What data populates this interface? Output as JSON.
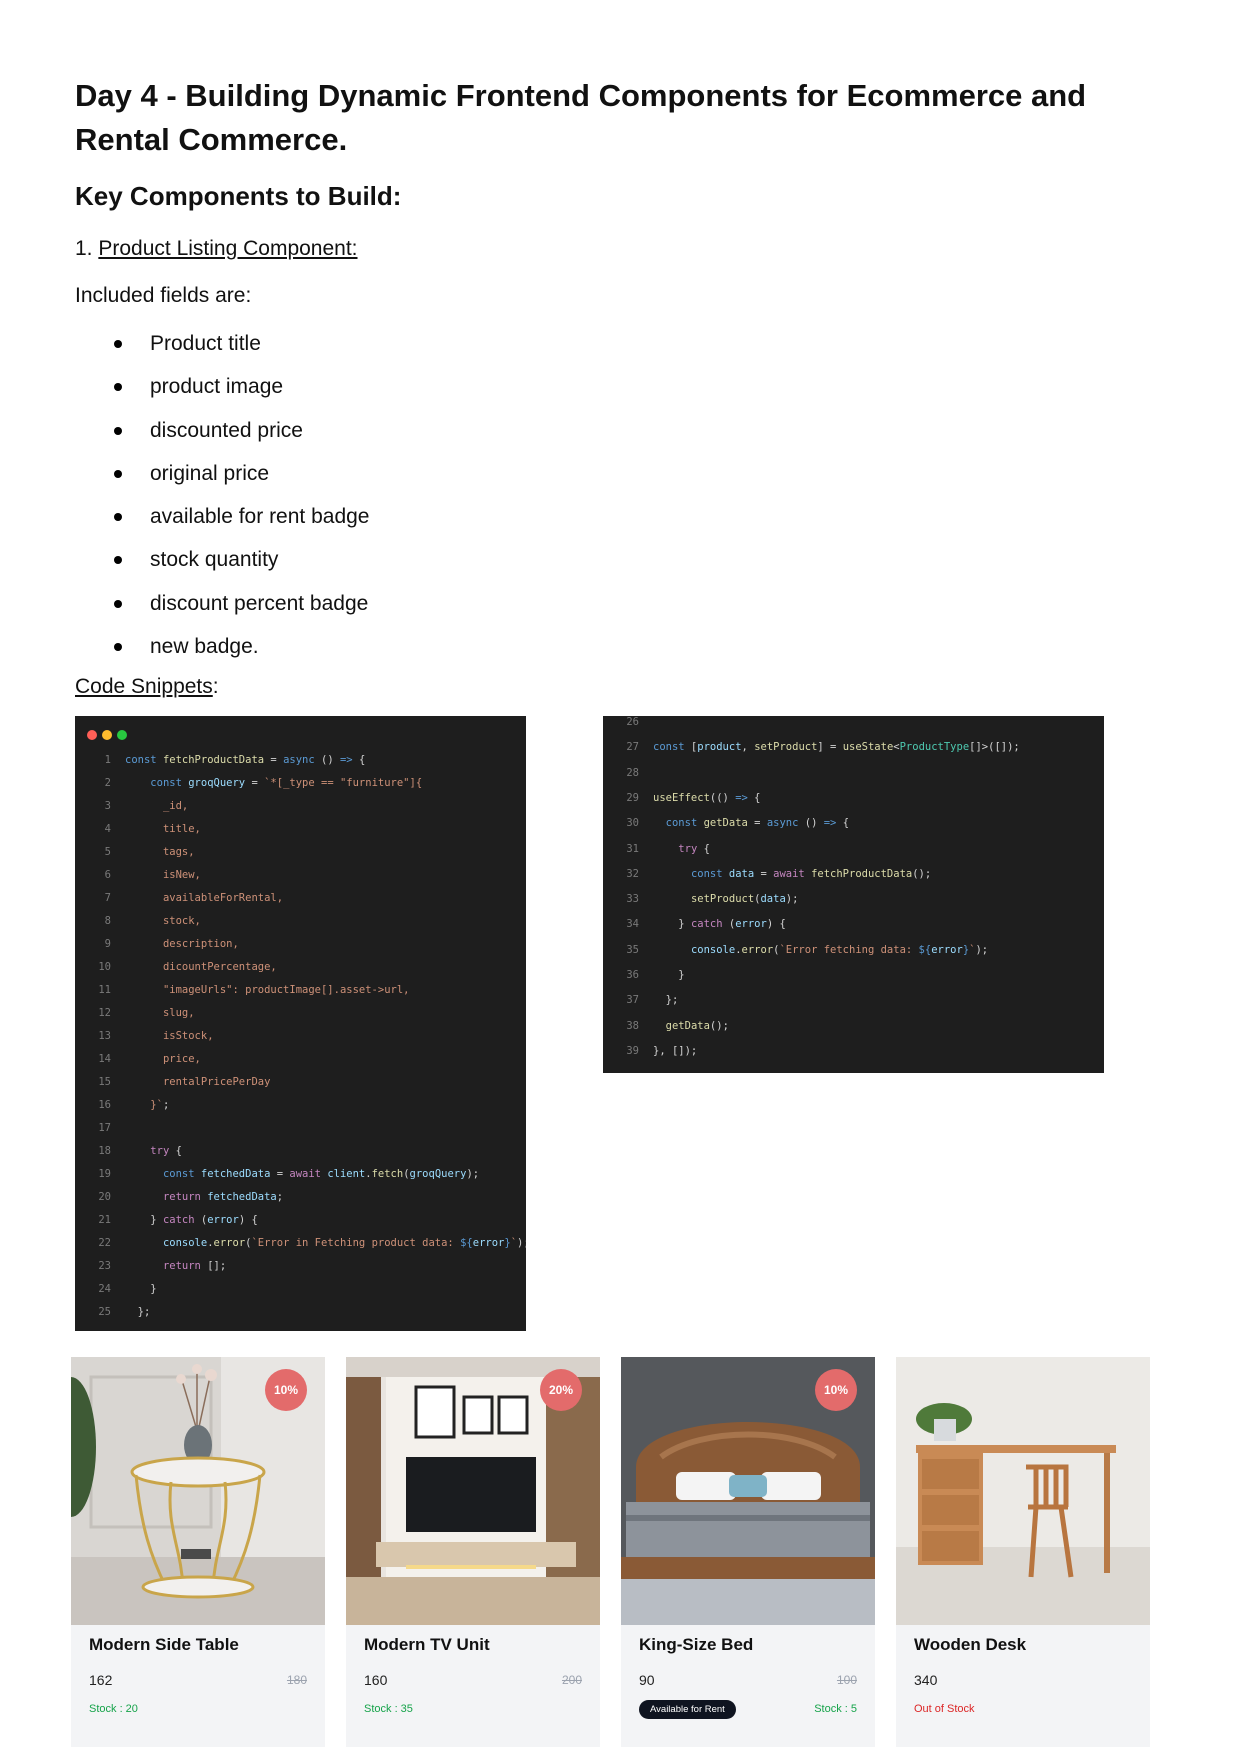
{
  "document": {
    "title": "Day 4 - Building Dynamic Frontend Components for Ecommerce and Rental Commerce.",
    "subtitle": "Key Components to Build:",
    "section_number": "1.",
    "section_title": "Product Listing Component:",
    "intro": "Included fields are:",
    "fields": [
      "Product title",
      "product image",
      "discounted price",
      "original price",
      "available for rent badge",
      "stock quantity",
      "discount percent badge",
      "new badge."
    ],
    "snippets_label": "Code Snippets",
    "snippets_colon": ":"
  },
  "colors": {
    "code_bg": "#1e1e1e",
    "window_dots": [
      "#ff5f57",
      "#febc2e",
      "#28c840"
    ],
    "discount_badge": "#e36b6b",
    "stock_in": "#16a34a",
    "stock_out": "#dc2626",
    "rent_badge": "#0f1420"
  },
  "code_left": {
    "lines": [
      {
        "n": "1",
        "html": "<span class=\"kw\">const</span> <span class=\"fn\">fetchProductData</span> = <span class=\"kw\">async</span> () <span class=\"kw\">=&gt;</span> {"
      },
      {
        "n": "2",
        "html": "    <span class=\"kw\">const</span> <span class=\"var\">groqQuery</span> = <span class=\"str\">`*[_type == \"furniture\"]{</span>"
      },
      {
        "n": "3",
        "html": "      <span class=\"str\">_id,</span>"
      },
      {
        "n": "4",
        "html": "      <span class=\"str\">title,</span>"
      },
      {
        "n": "5",
        "html": "      <span class=\"str\">tags,</span>"
      },
      {
        "n": "6",
        "html": "      <span class=\"str\">isNew,</span>"
      },
      {
        "n": "7",
        "html": "      <span class=\"str\">availableForRental,</span>"
      },
      {
        "n": "8",
        "html": "      <span class=\"str\">stock,</span>"
      },
      {
        "n": "9",
        "html": "      <span class=\"str\">description,</span>"
      },
      {
        "n": "10",
        "html": "      <span class=\"str\">dicountPercentage,</span>"
      },
      {
        "n": "11",
        "html": "      <span class=\"str\">\"imageUrls\": productImage[].asset-&gt;url,</span>"
      },
      {
        "n": "12",
        "html": "      <span class=\"str\">slug,</span>"
      },
      {
        "n": "13",
        "html": "      <span class=\"str\">isStock,</span>"
      },
      {
        "n": "14",
        "html": "      <span class=\"str\">price,</span>"
      },
      {
        "n": "15",
        "html": "      <span class=\"str\">rentalPricePerDay</span>"
      },
      {
        "n": "16",
        "html": "    <span class=\"str\">}`</span>;"
      },
      {
        "n": "17",
        "html": ""
      },
      {
        "n": "18",
        "html": "    <span class=\"ctrl\">try</span> {"
      },
      {
        "n": "19",
        "html": "      <span class=\"kw\">const</span> <span class=\"var\">fetchedData</span> = <span class=\"ctrl\">await</span> <span class=\"var\">client</span>.<span class=\"fn\">fetch</span>(<span class=\"var\">groqQuery</span>);"
      },
      {
        "n": "20",
        "html": "      <span class=\"ctrl\">return</span> <span class=\"var\">fetchedData</span>;"
      },
      {
        "n": "21",
        "html": "    } <span class=\"ctrl\">catch</span> (<span class=\"var\">error</span>) {"
      },
      {
        "n": "22",
        "html": "      <span class=\"var\">console</span>.<span class=\"fn\">error</span>(<span class=\"str\">`Error in Fetching product data: </span><span class=\"kw\">${</span><span class=\"var\">error</span><span class=\"kw\">}</span><span class=\"str\">`</span>);"
      },
      {
        "n": "23",
        "html": "      <span class=\"ctrl\">return</span> [];"
      },
      {
        "n": "24",
        "html": "    }"
      },
      {
        "n": "25",
        "html": "  };"
      }
    ]
  },
  "code_right": {
    "lines": [
      {
        "n": "26",
        "html": ""
      },
      {
        "n": "27",
        "html": "<span class=\"kw\">const</span> [<span class=\"var\">product</span>, <span class=\"fn\">setProduct</span>] = <span class=\"fn\">useState</span>&lt;<span class=\"type\">ProductType</span>[]&gt;([]);"
      },
      {
        "n": "28",
        "html": ""
      },
      {
        "n": "29",
        "html": "<span class=\"fn\">useEffect</span>(() <span class=\"kw\">=&gt;</span> {"
      },
      {
        "n": "30",
        "html": "  <span class=\"kw\">const</span> <span class=\"fn\">getData</span> = <span class=\"kw\">async</span> () <span class=\"kw\">=&gt;</span> {"
      },
      {
        "n": "31",
        "html": "    <span class=\"ctrl\">try</span> {"
      },
      {
        "n": "32",
        "html": "      <span class=\"kw\">const</span> <span class=\"var\">data</span> = <span class=\"ctrl\">await</span> <span class=\"fn\">fetchProductData</span>();"
      },
      {
        "n": "33",
        "html": "      <span class=\"fn\">setProduct</span>(<span class=\"var\">data</span>);"
      },
      {
        "n": "34",
        "html": "    } <span class=\"ctrl\">catch</span> (<span class=\"var\">error</span>) {"
      },
      {
        "n": "35",
        "html": "      <span class=\"var\">console</span>.<span class=\"fn\">error</span>(<span class=\"str\">`Error fetching data: </span><span class=\"kw\">${</span><span class=\"var\">error</span><span class=\"kw\">}</span><span class=\"str\">`</span>);"
      },
      {
        "n": "36",
        "html": "    }"
      },
      {
        "n": "37",
        "html": "  };"
      },
      {
        "n": "38",
        "html": "  <span class=\"fn\">getData</span>();"
      },
      {
        "n": "39",
        "html": "}, []);"
      }
    ]
  },
  "products": [
    {
      "title": "Modern Side Table",
      "price": "162",
      "original_price": "180",
      "discount_badge": "10%",
      "stock_text": "Stock : 20",
      "in_stock": true,
      "rent_badge": ""
    },
    {
      "title": "Modern TV Unit",
      "price": "160",
      "original_price": "200",
      "discount_badge": "20%",
      "stock_text": "Stock : 35",
      "in_stock": true,
      "rent_badge": ""
    },
    {
      "title": "King-Size Bed",
      "price": "90",
      "original_price": "100",
      "discount_badge": "10%",
      "stock_text": "Stock : 5",
      "in_stock": true,
      "rent_badge": "Available for Rent"
    },
    {
      "title": "Wooden Desk",
      "price": "340",
      "original_price": "",
      "discount_badge": "",
      "stock_text": "Out of Stock",
      "in_stock": false,
      "rent_badge": ""
    }
  ]
}
